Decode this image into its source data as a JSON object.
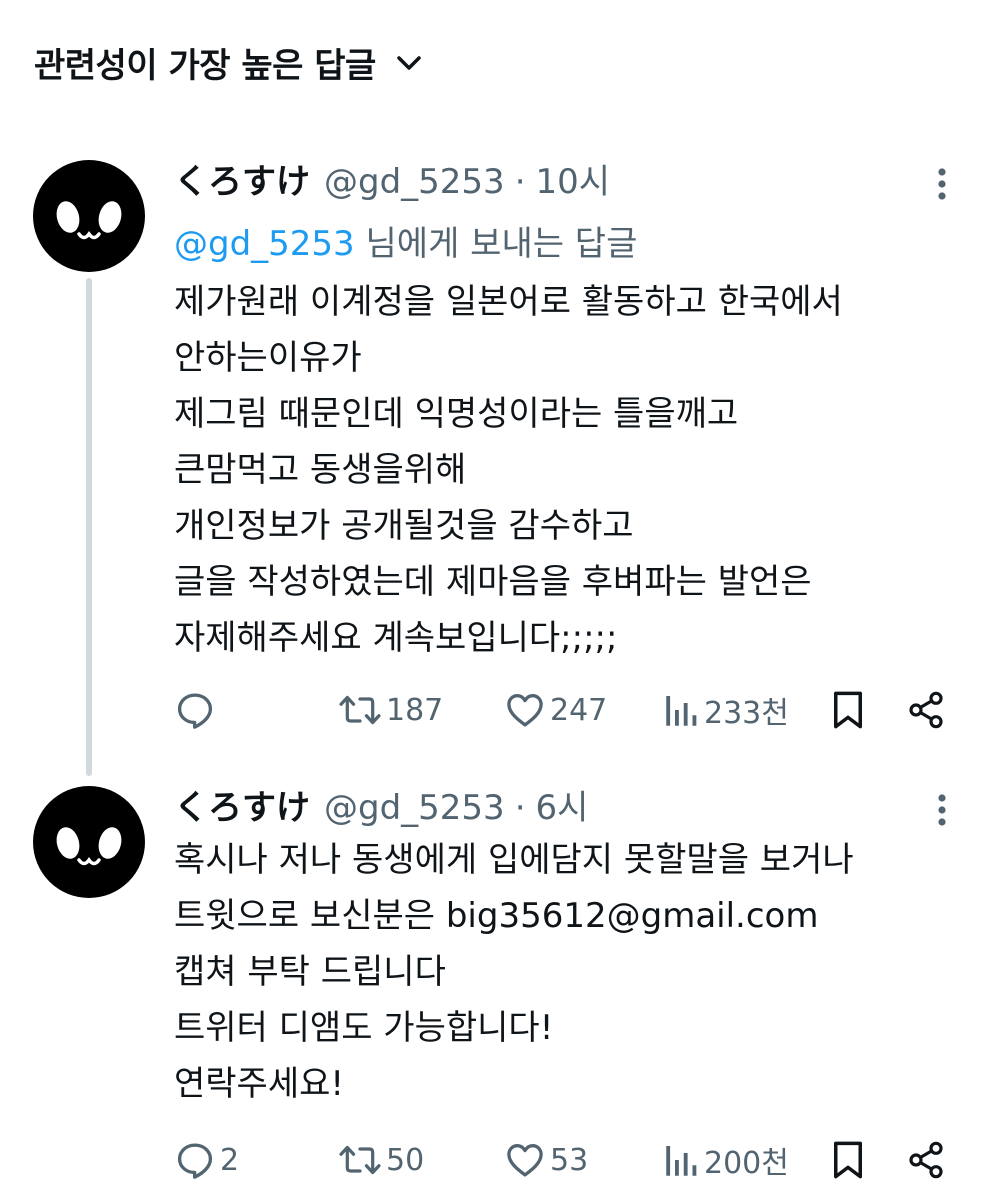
{
  "sort": {
    "label": "관련성이 가장 높은 답글"
  },
  "tweets": [
    {
      "display_name": "くろすけ",
      "handle": "@gd_5253",
      "separator": "·",
      "time": "10시",
      "replying_to_mention": "@gd_5253",
      "replying_to_suffix": " 님에게 보내는 답글",
      "lines": [
        "제가원래 이계정을 일본어로 활동하고 한국에서",
        "안하는이유가",
        "제그림 때문인데 익명성이라는 틀을깨고",
        "큰맘먹고 동생을위해",
        "개인정보가 공개될것을 감수하고",
        "글을 작성하였는데 제마음을 후벼파는 발언은",
        "자제해주세요 계속보입니다;;;;;"
      ],
      "reply_count": "",
      "retweet_count": "187",
      "like_count": "247",
      "view_count": "233천"
    },
    {
      "display_name": "くろすけ",
      "handle": "@gd_5253",
      "separator": "·",
      "time": "6시",
      "lines": [
        "혹시나 저나 동생에게 입에담지 못할말을 보거나",
        "트윗으로 보신분은 big35612@gmail.com",
        "캡쳐 부탁 드립니다",
        "트위터 디앰도 가능합니다!",
        "연락주세요!"
      ],
      "reply_count": "2",
      "retweet_count": "50",
      "like_count": "53",
      "view_count": "200천"
    }
  ],
  "icons": {
    "sort": "chevron-down-icon",
    "avatar_face": "avatar-face",
    "more": "more-vertical-icon",
    "reply": "reply-icon",
    "retweet": "retweet-icon",
    "like": "heart-icon",
    "views": "views-icon",
    "bookmark": "bookmark-icon",
    "share": "share-icon"
  },
  "colors": {
    "text": "#0f1419",
    "secondary": "#536471",
    "link": "#1d9bf0",
    "thread_line": "#cfd9de"
  }
}
